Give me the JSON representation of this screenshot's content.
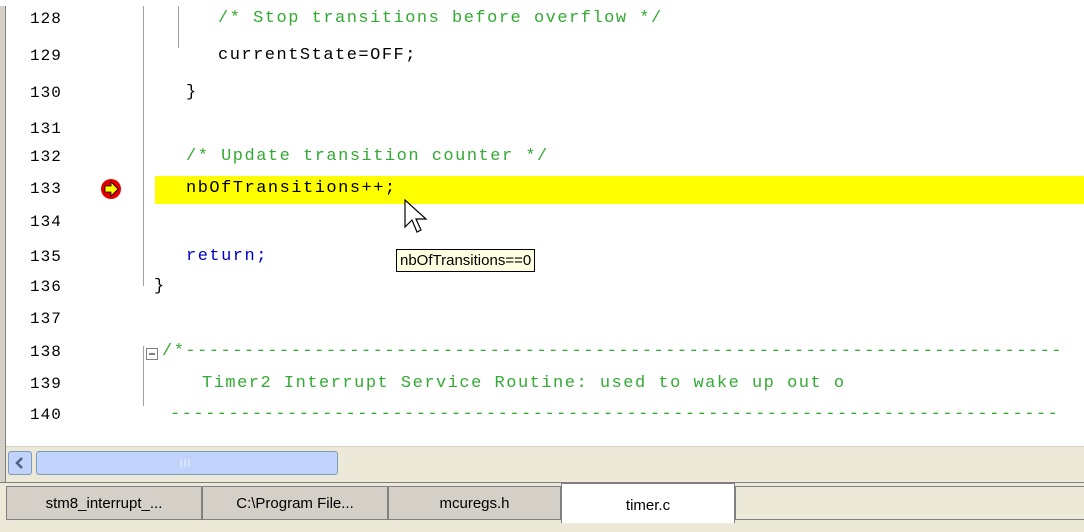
{
  "editor": {
    "lines": [
      {
        "num": "128",
        "code": "/* Stop transitions before overflow */",
        "kind": "comment",
        "indent": "       "
      },
      {
        "num": "129",
        "code": "currentState=OFF;",
        "kind": "code",
        "indent": "       "
      },
      {
        "num": "130",
        "code": "}",
        "kind": "code",
        "indent": "   "
      },
      {
        "num": "131",
        "code": "",
        "kind": "code",
        "indent": ""
      },
      {
        "num": "132",
        "code": "/* Update transition counter */",
        "kind": "comment",
        "indent": "   "
      },
      {
        "num": "133",
        "code": "nbOfTransitions++;",
        "kind": "code",
        "indent": "   "
      },
      {
        "num": "134",
        "code": "",
        "kind": "code",
        "indent": ""
      },
      {
        "num": "135",
        "code": "return;",
        "kind": "keyword",
        "indent": "   "
      },
      {
        "num": "136",
        "code": "}",
        "kind": "code",
        "indent": " "
      },
      {
        "num": "137",
        "code": "",
        "kind": "code",
        "indent": ""
      },
      {
        "num": "138",
        "code": "/*---------------------------------------------------------------------------",
        "kind": "comment",
        "indent": "  "
      },
      {
        "num": "139",
        "code": "Timer2 Interrupt Service Routine: used to wake up out o",
        "kind": "comment",
        "indent": "    "
      },
      {
        "num": "140",
        "code": "----------------------------------------------------------------------------",
        "kind": "comment",
        "indent": "  "
      }
    ],
    "current_line": "133",
    "tooltip": "nbOfTransitions==0"
  },
  "icons": {
    "breakpoint": "current-statement-arrow-icon",
    "cursor": "mouse-pointer-icon",
    "scroll_left": "scroll-left-arrow-icon",
    "fold": "fold-collapse-icon"
  },
  "tabs": [
    {
      "label": "stm8_interrupt_...",
      "active": false
    },
    {
      "label": "C:\\Program File...",
      "active": false
    },
    {
      "label": "mcuregs.h",
      "active": false
    },
    {
      "label": "timer.c",
      "active": true
    }
  ],
  "colors": {
    "highlight": "#ffff00",
    "comment": "#33aa33",
    "keyword": "#0000cc"
  }
}
